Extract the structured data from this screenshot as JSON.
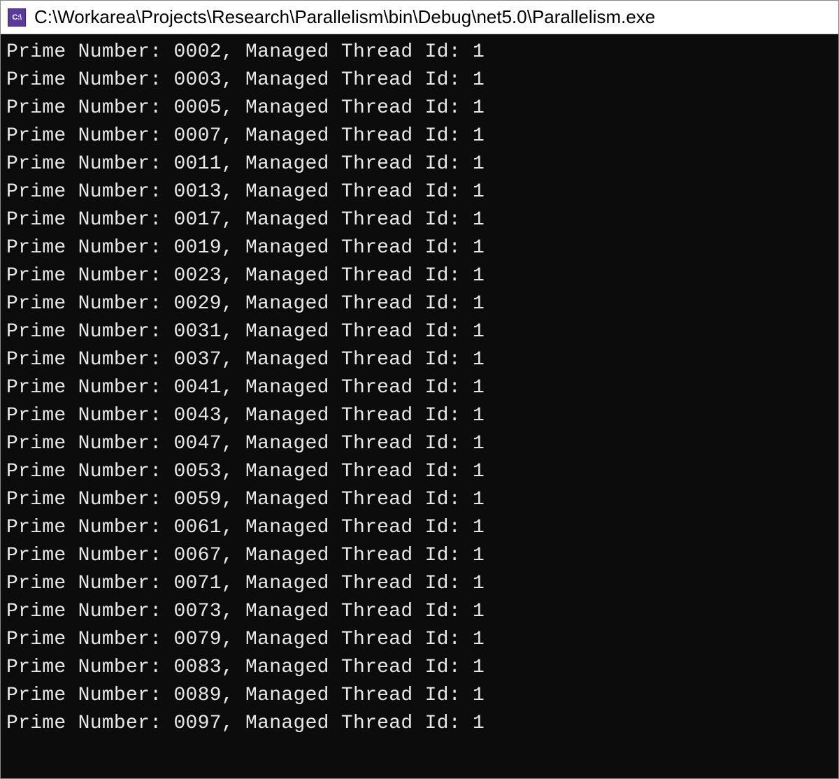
{
  "window": {
    "icon_label": "C:\\",
    "title": "C:\\Workarea\\Projects\\Research\\Parallelism\\bin\\Debug\\net5.0\\Parallelism.exe"
  },
  "console": {
    "line_prefix": "Prime Number: ",
    "line_mid": ", Managed Thread Id: ",
    "lines": [
      {
        "prime": "0002",
        "thread": "1"
      },
      {
        "prime": "0003",
        "thread": "1"
      },
      {
        "prime": "0005",
        "thread": "1"
      },
      {
        "prime": "0007",
        "thread": "1"
      },
      {
        "prime": "0011",
        "thread": "1"
      },
      {
        "prime": "0013",
        "thread": "1"
      },
      {
        "prime": "0017",
        "thread": "1"
      },
      {
        "prime": "0019",
        "thread": "1"
      },
      {
        "prime": "0023",
        "thread": "1"
      },
      {
        "prime": "0029",
        "thread": "1"
      },
      {
        "prime": "0031",
        "thread": "1"
      },
      {
        "prime": "0037",
        "thread": "1"
      },
      {
        "prime": "0041",
        "thread": "1"
      },
      {
        "prime": "0043",
        "thread": "1"
      },
      {
        "prime": "0047",
        "thread": "1"
      },
      {
        "prime": "0053",
        "thread": "1"
      },
      {
        "prime": "0059",
        "thread": "1"
      },
      {
        "prime": "0061",
        "thread": "1"
      },
      {
        "prime": "0067",
        "thread": "1"
      },
      {
        "prime": "0071",
        "thread": "1"
      },
      {
        "prime": "0073",
        "thread": "1"
      },
      {
        "prime": "0079",
        "thread": "1"
      },
      {
        "prime": "0083",
        "thread": "1"
      },
      {
        "prime": "0089",
        "thread": "1"
      },
      {
        "prime": "0097",
        "thread": "1"
      }
    ]
  }
}
